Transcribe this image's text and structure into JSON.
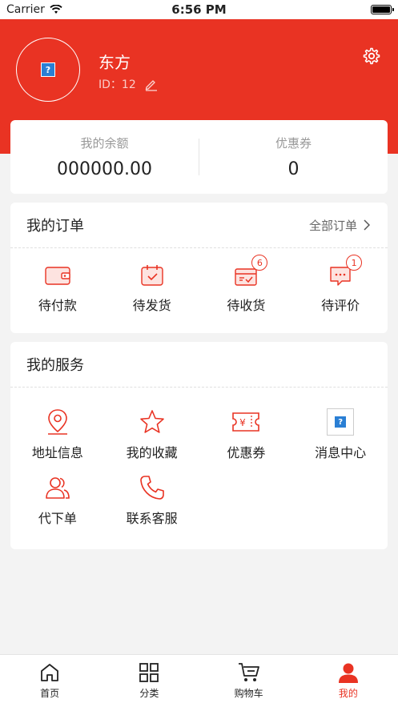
{
  "status_bar": {
    "carrier": "Carrier",
    "time": "6:56 PM"
  },
  "profile": {
    "name": "东方",
    "id_label": "ID：",
    "id_value": "12",
    "avatar_placeholder": "?"
  },
  "balance": {
    "balance_label": "我的余额",
    "balance_value": "000000.00",
    "coupon_label": "优惠券",
    "coupon_value": "0"
  },
  "orders": {
    "title": "我的订单",
    "all_label": "全部订单",
    "items": [
      {
        "label": "待付款",
        "icon": "wallet-icon",
        "badge": ""
      },
      {
        "label": "待发货",
        "icon": "calendar-check-icon",
        "badge": ""
      },
      {
        "label": "待收货",
        "icon": "package-icon",
        "badge": "6"
      },
      {
        "label": "待评价",
        "icon": "comment-icon",
        "badge": "1"
      }
    ]
  },
  "services": {
    "title": "我的服务",
    "items": [
      {
        "label": "地址信息",
        "icon": "location-pin-icon"
      },
      {
        "label": "我的收藏",
        "icon": "star-icon"
      },
      {
        "label": "优惠券",
        "icon": "coupon-icon"
      },
      {
        "label": "消息中心",
        "icon": "image-placeholder-icon",
        "placeholder": "?"
      },
      {
        "label": "代下单",
        "icon": "users-icon"
      },
      {
        "label": "联系客服",
        "icon": "phone-icon"
      }
    ]
  },
  "tabs": [
    {
      "label": "首页",
      "icon": "home-icon"
    },
    {
      "label": "分类",
      "icon": "grid-icon"
    },
    {
      "label": "购物车",
      "icon": "cart-icon"
    },
    {
      "label": "我的",
      "icon": "user-icon",
      "active": true
    }
  ],
  "colors": {
    "accent": "#e93323",
    "background": "#f3f3f3"
  }
}
